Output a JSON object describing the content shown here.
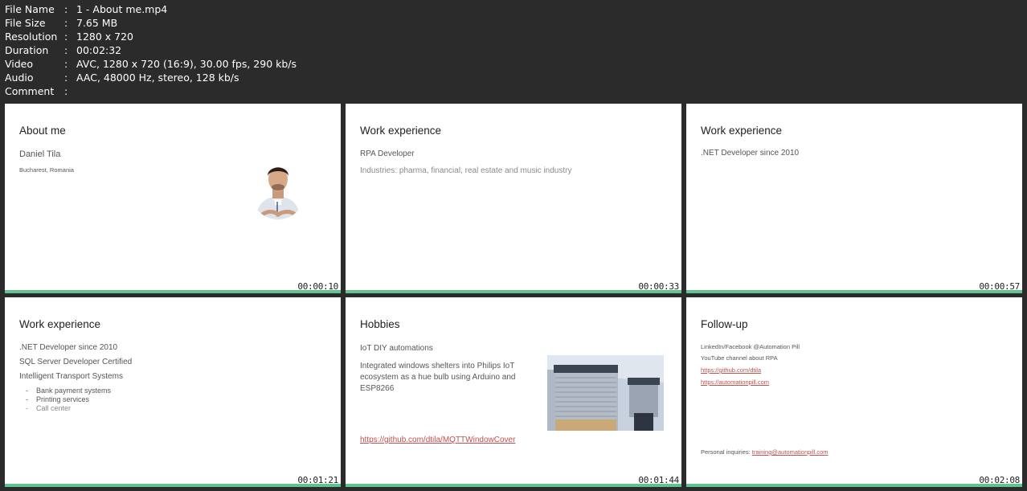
{
  "meta": [
    {
      "key": "File Name",
      "value": "1 - About me.mp4"
    },
    {
      "key": "File Size",
      "value": "7.65 MB"
    },
    {
      "key": "Resolution",
      "value": "1280 x 720"
    },
    {
      "key": "Duration",
      "value": "00:02:32"
    },
    {
      "key": "Video",
      "value": "AVC, 1280 x 720 (16:9), 30.00 fps, 290 kb/s"
    },
    {
      "key": "Audio",
      "value": "AAC, 48000 Hz, stereo, 128 kb/s"
    },
    {
      "key": "Comment",
      "value": ""
    }
  ],
  "separator": ":",
  "colors": {
    "background": "#2b2b2b",
    "progress_bar": "#5ec592",
    "link": "#c0504d"
  },
  "thumbs": [
    {
      "timestamp": "00:00:10",
      "title": "About me",
      "name": "Daniel Tila",
      "location": "Bucharest, Romania",
      "image": "profile-photo"
    },
    {
      "timestamp": "00:00:33",
      "title": "Work experience",
      "role": "RPA Developer",
      "industries": "Industries: pharma, financial, real estate and music industry"
    },
    {
      "timestamp": "00:00:57",
      "title": "Work experience",
      "line1": ".NET Developer since 2010"
    },
    {
      "timestamp": "00:01:21",
      "title": "Work experience",
      "line1": ".NET Developer since 2010",
      "line2": "SQL Server Developer Certified",
      "line3": "Intelligent Transport Systems",
      "bullets": [
        "Bank payment systems",
        "Printing services",
        "Call center"
      ]
    },
    {
      "timestamp": "00:01:44",
      "title": "Hobbies",
      "line1": "IoT DIY automations",
      "desc": "Integrated windows shelters into Philips IoT ecosystem as a hue bulb using Arduino and ESP8266",
      "link": "https://github.com/dtila/MQTTWindowCover",
      "image": "window-shutter-photo"
    },
    {
      "timestamp": "00:02:08",
      "title": "Follow-up",
      "line1": "LinkedIn/Facebook @Automation Pill",
      "line2": "YouTube channel about RPA",
      "link1": "https://github.com/dtila",
      "link2": "https://automationpill.com",
      "inquiry_label": "Personal inquiries:",
      "inquiry_link": "training@automationpill.com"
    }
  ]
}
